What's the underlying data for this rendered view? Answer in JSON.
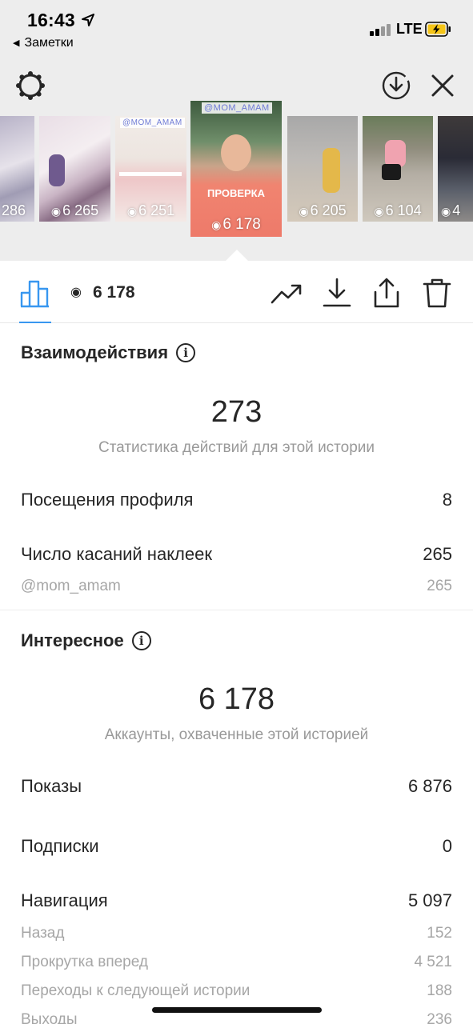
{
  "status_bar": {
    "time": "16:43",
    "back_label": "Заметки",
    "network": "LTE"
  },
  "icons": {
    "settings": "settings-icon",
    "download_circle": "download-circle-icon",
    "close": "close-icon",
    "stats": "bar-chart-icon",
    "views": "eye-icon",
    "promote": "trending-up-icon",
    "save": "download-icon",
    "share": "share-icon",
    "delete": "trash-icon",
    "info": "info-icon"
  },
  "thumbnails": [
    {
      "views": "286"
    },
    {
      "views": "6 265"
    },
    {
      "views": "6 251",
      "tag": "@MOM_AMAM"
    },
    {
      "views": "6 178",
      "tag": "@MOM_AMAM",
      "overlay": "ПРОВЕРКА",
      "selected": true
    },
    {
      "views": "6 205"
    },
    {
      "views": "6 104"
    },
    {
      "views": "4"
    }
  ],
  "toolbar": {
    "views": "6 178"
  },
  "interactions": {
    "title": "Взаимодействия",
    "total": "273",
    "caption": "Статистика действий для этой истории",
    "rows": [
      {
        "label": "Посещения профиля",
        "value": "8"
      },
      {
        "label": "Число касаний наклеек",
        "value": "265"
      }
    ],
    "sub_rows": [
      {
        "label": "@mom_amam",
        "value": "265"
      }
    ]
  },
  "discovery": {
    "title": "Интересное",
    "total": "6 178",
    "caption": "Аккаунты, охваченные этой историей",
    "rows": [
      {
        "label": "Показы",
        "value": "6 876"
      },
      {
        "label": "Подписки",
        "value": "0"
      },
      {
        "label": "Навигация",
        "value": "5 097"
      }
    ],
    "sub_rows": [
      {
        "label": "Назад",
        "value": "152"
      },
      {
        "label": "Прокрутка вперед",
        "value": "4 521"
      },
      {
        "label": "Переходы к следующей истории",
        "value": "188"
      },
      {
        "label": "Выходы",
        "value": "236"
      }
    ]
  },
  "colors": {
    "accent": "#3897f0",
    "text": "#262626",
    "muted": "#999999",
    "top_background": "#ededed"
  }
}
